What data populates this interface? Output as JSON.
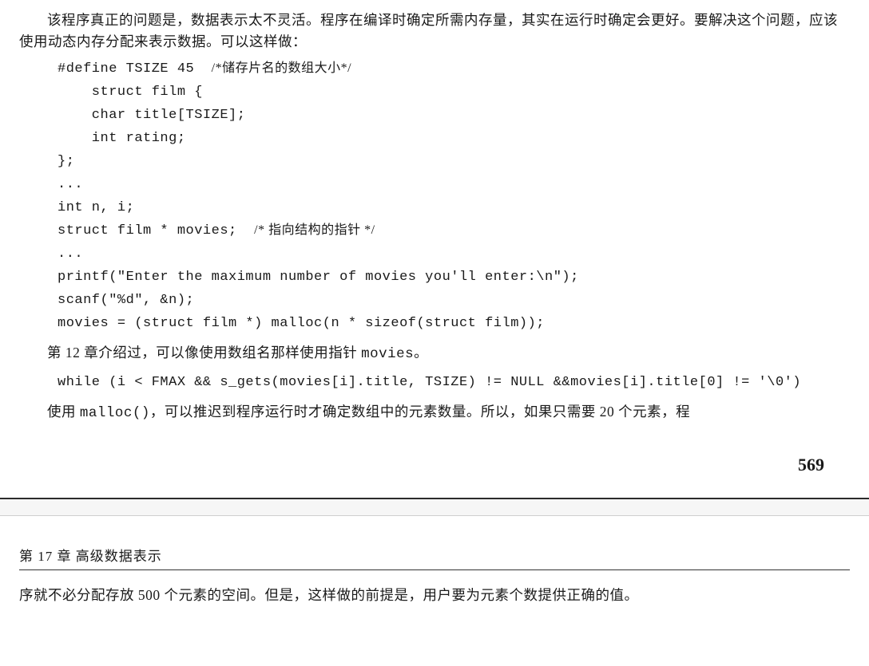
{
  "p1": "该程序真正的问题是，数据表示太不灵活。程序在编译时确定所需内存量，其实在运行时确定会更好。要解决这个问题，应该使用动态内存分配来表示数据。可以这样做：",
  "code1_line1_a": "#define TSIZE 45  ",
  "code1_line1_b": "/*储存片名的数组大小*/",
  "code1_line2": "    struct film {",
  "code1_line3": "    char title[TSIZE];",
  "code1_line4": "    int rating;",
  "code1_line5": "};",
  "code1_line6": "...",
  "code1_line7": "int n, i;",
  "code1_line8_a": "struct film * movies;  ",
  "code1_line8_b": "/* 指向结构的指针 */",
  "code1_line9": "...",
  "code1_line10": "printf(\"Enter the maximum number of movies you'll enter:\\n\");",
  "code1_line11": "scanf(\"%d\", &n);",
  "code1_line12": "movies = (struct film *) malloc(n * sizeof(struct film));",
  "p2_a": "第 12 章介绍过，可以像使用数组名那样使用指针 ",
  "p2_b": "movies",
  "p2_c": "。",
  "code2": "while (i < FMAX && s_gets(movies[i].title, TSIZE) != NULL &&movies[i].title[0] != '\\0')",
  "p3_a": "使用 ",
  "p3_b": "malloc()",
  "p3_c": "，可以推迟到程序运行时才确定数组中的元素数量。所以，如果只需要 20 个元素，程",
  "page_num": "569",
  "chapter": "第 17 章  高级数据表示",
  "p4": "序就不必分配存放 500 个元素的空间。但是，这样做的前提是，用户要为元素个数提供正确的值。"
}
